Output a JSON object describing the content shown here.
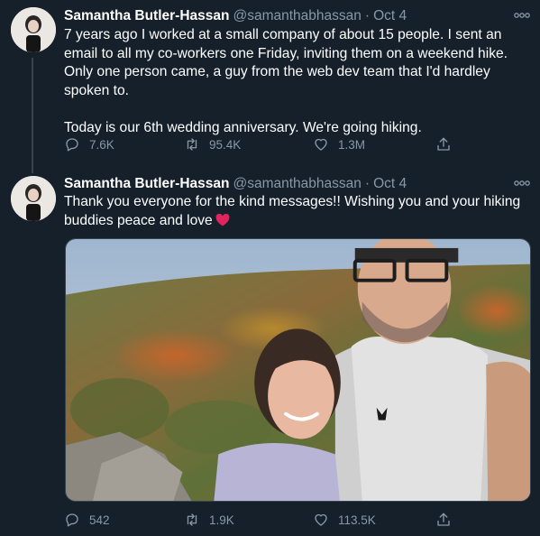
{
  "tweets": [
    {
      "author": "Samantha Butler-Hassan",
      "handle": "@samanthabhassan",
      "separator": "·",
      "date": "Oct 4",
      "paragraphs": [
        "7 years ago I worked at a small company of about 15 people. I sent an email to all my co-workers one Friday, inviting them on a weekend hike. Only one person came, a guy from the web dev team that I'd hardley spoken to.",
        "Today is our 6th wedding anniversary. We're going hiking."
      ],
      "replies": "7.6K",
      "retweets": "95.4K",
      "likes": "1.3M"
    },
    {
      "author": "Samantha Butler-Hassan",
      "handle": "@samanthabhassan",
      "separator": "·",
      "date": "Oct 4",
      "paragraphs": [
        "Thank you everyone for the kind messages!! Wishing you and your hiking buddies peace and love"
      ],
      "replies": "542",
      "retweets": "1.9K",
      "likes": "113.5K"
    }
  ],
  "icons": {
    "reply": "reply-icon",
    "retweet": "retweet-icon",
    "like": "heart-icon",
    "share": "share-icon",
    "more": "more-icon",
    "inline_emoji": "red-heart-emoji"
  },
  "colors": {
    "background": "#15202b",
    "text": "#ffffff",
    "secondary": "#8899a6",
    "divider": "#38444d",
    "heart": "#e0245e"
  }
}
